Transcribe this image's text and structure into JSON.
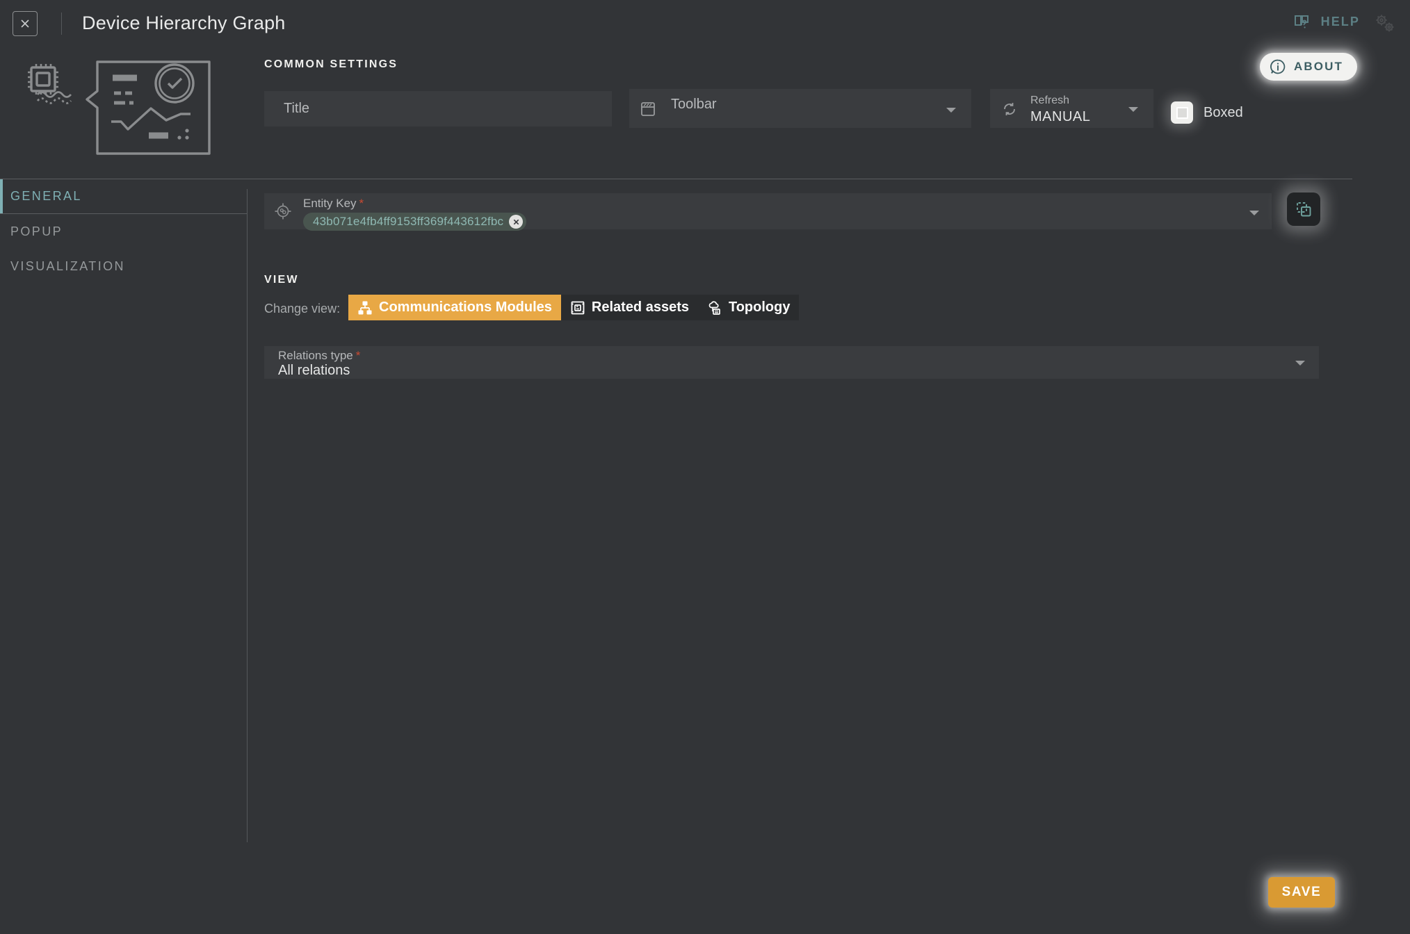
{
  "header": {
    "title": "Device Hierarchy Graph",
    "close_icon": "close-x-icon",
    "help_label": "HELP",
    "help_icon": "book-question-icon",
    "gears_icon": "gears-icon",
    "about_label": "ABOUT",
    "about_icon": "info-bubble-icon"
  },
  "illustration": {
    "name": "device-dashboard-illustration"
  },
  "common_settings": {
    "section_label": "COMMON SETTINGS",
    "title_field": {
      "placeholder": "Title",
      "value": ""
    },
    "toolbar_field": {
      "label": "Toolbar",
      "value": "",
      "icon": "toolbar-panel-icon"
    },
    "refresh_field": {
      "label": "Refresh",
      "value": "MANUAL",
      "icon": "refresh-icon"
    },
    "boxed_checkbox": {
      "label": "Boxed",
      "checked": true
    }
  },
  "sidebar": {
    "tabs": [
      {
        "label": "GENERAL",
        "active": true
      },
      {
        "label": "POPUP",
        "active": false
      },
      {
        "label": "VISUALIZATION",
        "active": false
      }
    ]
  },
  "entity_key": {
    "label": "Entity Key",
    "required_marker": "*",
    "icon": "target-crosshair-icon",
    "chip_value": "43b071e4fb4ff9153ff369f443612fbc",
    "chip_remove_icon": "close-x-icon",
    "copy_button_icon": "duplicate-icon"
  },
  "view": {
    "section_label": "VIEW",
    "change_view_label": "Change view:",
    "options": [
      {
        "label": "Communications Modules",
        "icon": "hierarchy-icon",
        "active": true
      },
      {
        "label": "Related assets",
        "icon": "related-assets-icon",
        "active": false
      },
      {
        "label": "Topology",
        "icon": "topology-icon",
        "active": false
      }
    ]
  },
  "relations_type": {
    "label": "Relations type",
    "required_marker": "*",
    "value": "All relations"
  },
  "footer": {
    "save_label": "SAVE"
  },
  "colors": {
    "background": "#323437",
    "field_background": "#3a3c3f",
    "accent_orange": "#e8a845",
    "accent_teal": "#7fb0b4",
    "save_orange": "#d99a33",
    "required_red": "#c94a32",
    "chip_background": "#49554f",
    "chip_text": "#8fb9b3"
  }
}
